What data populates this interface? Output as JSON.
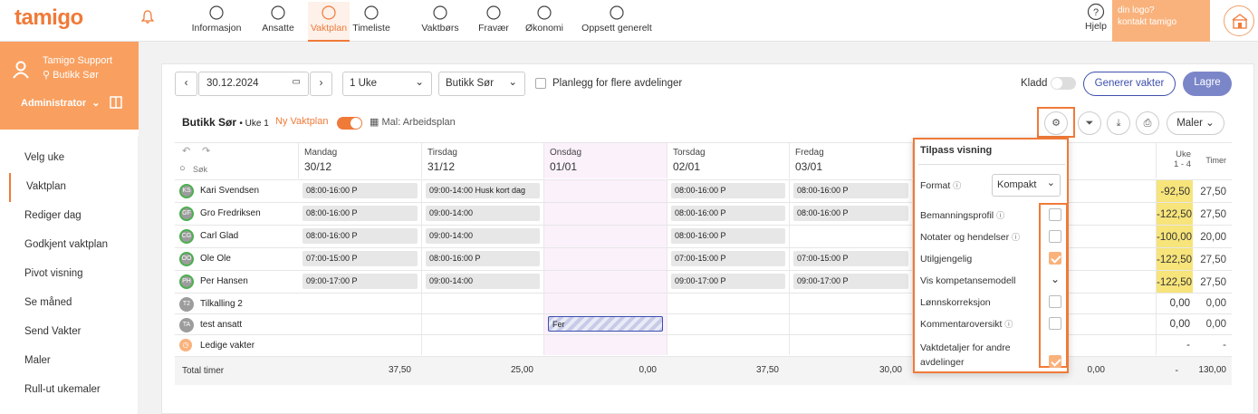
{
  "app": {
    "logo": "tamigo",
    "help": "Hjelp",
    "logo_box_line1": "din logo?",
    "logo_box_line2": "kontakt tamigo"
  },
  "nav": [
    {
      "label": "Informasjon",
      "icon": "info-icon"
    },
    {
      "label": "Ansatte",
      "icon": "people-icon"
    },
    {
      "label": "Vaktplan",
      "icon": "calendar-icon"
    },
    {
      "label": "Timeliste",
      "icon": "timesheet-icon"
    },
    {
      "label": "Vaktbørs",
      "icon": "swap-icon"
    },
    {
      "label": "Fravær",
      "icon": "absence-icon"
    },
    {
      "label": "Økonomi",
      "icon": "economy-icon"
    },
    {
      "label": "Oppsett generelt",
      "icon": "gear-icon"
    }
  ],
  "profile": {
    "name": "Tamigo Support",
    "location": "Butikk Sør",
    "role": "Administrator"
  },
  "sidebar": [
    "Velg uke",
    "Vaktplan",
    "Rediger dag",
    "Godkjent vaktplan",
    "Pivot visning",
    "Se måned",
    "Send Vakter",
    "Maler",
    "Rull-ut ukemaler"
  ],
  "toolbar": {
    "date": "30.12.2024",
    "period": "1 Uke",
    "department": "Butikk Sør",
    "multi_dept": "Planlegg for flere avdelinger",
    "draft": "Kladd",
    "generate": "Generer vakter",
    "save": "Lagre"
  },
  "subheader": {
    "title": "Butikk Sør",
    "week": "• Uke 1",
    "new_plan": "Ny Vaktplan",
    "template": "Mal: Arbeidsplan",
    "templates_btn": "Maler"
  },
  "search_placeholder": "Søk",
  "days": [
    {
      "name": "Mandag",
      "date": "30/12"
    },
    {
      "name": "Tirsdag",
      "date": "31/12"
    },
    {
      "name": "Onsdag",
      "date": "01/01"
    },
    {
      "name": "Torsdag",
      "date": "02/01"
    },
    {
      "name": "Fredag",
      "date": "03/01"
    }
  ],
  "week_col": {
    "line1": "Uke",
    "line2": "1 - 4"
  },
  "hours_col": "Timer",
  "employees": [
    {
      "initials": "KS",
      "name": "Kari Svendsen",
      "shifts": [
        "08:00-16:00 P",
        "09:00-14:00 Husk kort dag",
        "",
        "08:00-16:00 P",
        "08:00-16:00 P"
      ],
      "week": "-92,50",
      "hours": "27,50"
    },
    {
      "initials": "GF",
      "name": "Gro Fredriksen",
      "shifts": [
        "08:00-16:00 P",
        "09:00-14:00",
        "",
        "08:00-16:00 P",
        "08:00-16:00 P"
      ],
      "week": "-122,50",
      "hours": "27,50"
    },
    {
      "initials": "CG",
      "name": "Carl Glad",
      "shifts": [
        "08:00-16:00 P",
        "09:00-14:00",
        "",
        "08:00-16:00 P",
        ""
      ],
      "week": "-100,00",
      "hours": "20,00"
    },
    {
      "initials": "OO",
      "name": "Ole Ole",
      "shifts": [
        "07:00-15:00 P",
        "08:00-16:00 P",
        "",
        "07:00-15:00 P",
        "07:00-15:00 P"
      ],
      "week": "-122,50",
      "hours": "27,50"
    },
    {
      "initials": "PH",
      "name": "Per Hansen",
      "shifts": [
        "09:00-17:00 P",
        "09:00-14:00",
        "",
        "09:00-17:00 P",
        "09:00-17:00 P"
      ],
      "week": "-122,50",
      "hours": "27,50"
    },
    {
      "initials": "T2",
      "name": "Tilkalling 2",
      "shifts": [
        "",
        "",
        "",
        "",
        ""
      ],
      "week": "0,00",
      "hours": "0,00"
    },
    {
      "initials": "TA",
      "name": "test ansatt",
      "shifts": [
        "",
        "",
        "Fer",
        "",
        ""
      ],
      "week": "0,00",
      "hours": "0,00"
    },
    {
      "initials": "",
      "name": "Ledige vakter",
      "shifts": [
        "",
        "",
        "",
        "",
        ""
      ],
      "week": "-",
      "hours": "-"
    }
  ],
  "totals": {
    "label": "Total timer",
    "values": [
      "37,50",
      "25,00",
      "0,00",
      "37,50",
      "30,00"
    ],
    "extra": "0,00",
    "week": "-",
    "hours": "130,00"
  },
  "popup": {
    "title": "Tilpass visning",
    "format_label": "Format",
    "format_value": "Kompakt",
    "options": [
      {
        "label": "Bemanningsprofil",
        "info": true,
        "checked": false
      },
      {
        "label": "Notater og hendelser",
        "info": true,
        "checked": false
      },
      {
        "label": "Utilgjengelig",
        "info": false,
        "checked": true
      },
      {
        "label": "Vis kompetansemodell",
        "info": false,
        "checked": null
      },
      {
        "label": "Lønnskorreksjon",
        "info": false,
        "checked": false
      },
      {
        "label": "Kommentaroversikt",
        "info": true,
        "checked": false
      },
      {
        "label": "Vaktdetaljer for andre avdelinger",
        "info": false,
        "checked": true
      }
    ]
  },
  "colors": {
    "accent": "#f07a38",
    "highlight": "#f7e47a",
    "profile_bg": "#f9a060",
    "primary_btn": "#7b86c9"
  }
}
